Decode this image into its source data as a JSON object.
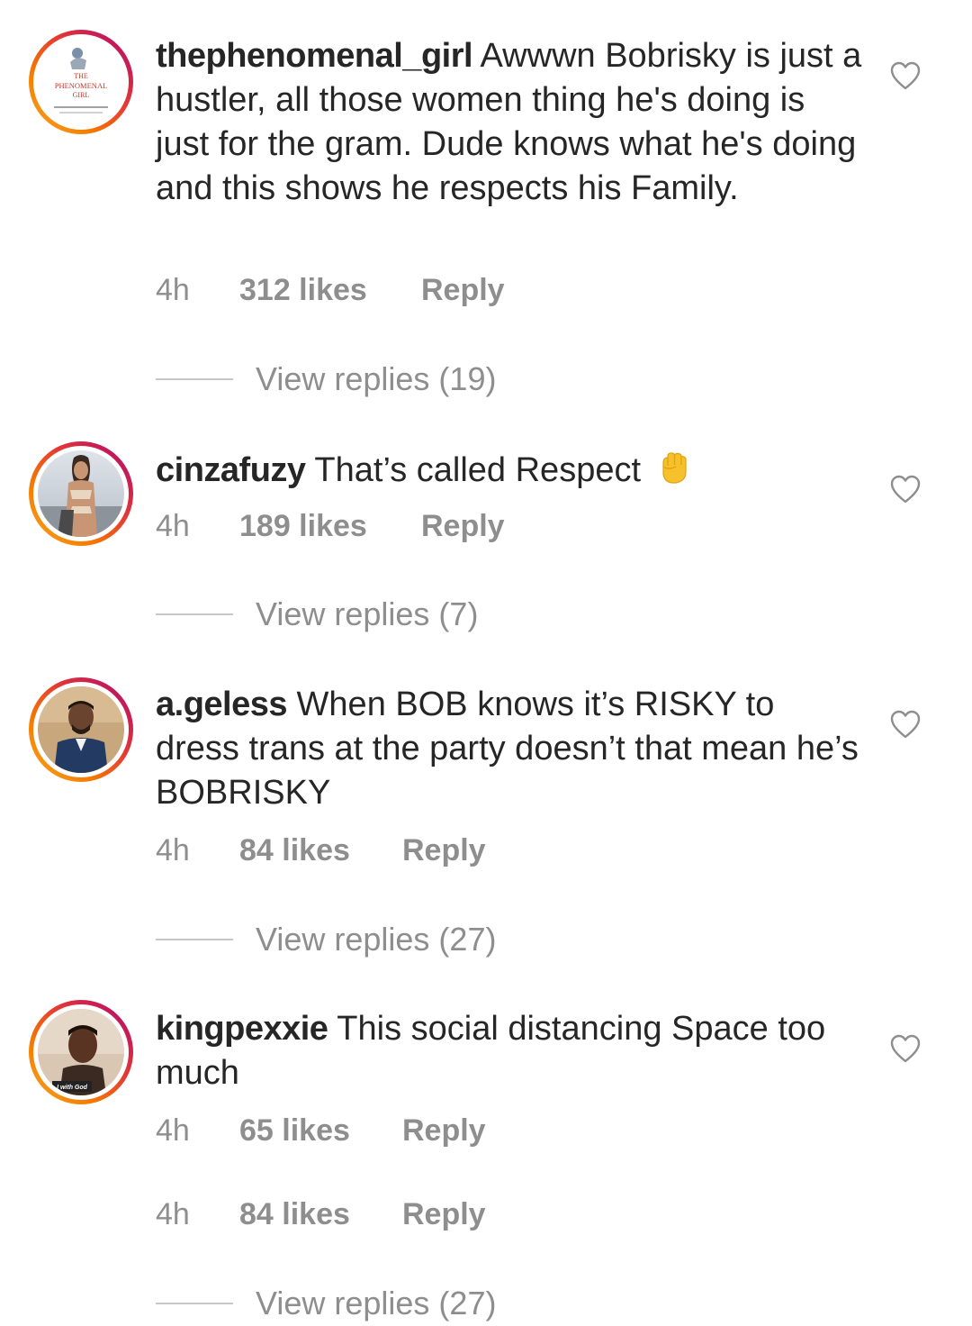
{
  "comments": [
    {
      "username": "thephenomenal_girl",
      "text": " Awwwn Bobrisky is just a hustler, all those women thing he's doing is just for the gram. Dude knows what he's doing and this shows he respects his Family.",
      "avatar_lines": [
        "THE",
        "PHENOMENAL",
        "GIRL"
      ],
      "time": "4h",
      "likes": "312 likes",
      "reply": "Reply",
      "view_replies": "View replies (19)"
    },
    {
      "username": "cinzafuzy",
      "text": " That’s called Respect ",
      "emoji": "✊",
      "time": "4h",
      "likes": "189 likes",
      "reply": "Reply",
      "view_replies": "View replies (7)"
    },
    {
      "username": "a.geless",
      "text": " When BOB knows it’s RISKY to dress trans at the party doesn’t that mean he’s BOBRISKY",
      "time": "4h",
      "likes": "84 likes",
      "reply": "Reply",
      "view_replies": "View replies (27)"
    },
    {
      "username": "kingpexxie",
      "text": " This social distancing Space too much",
      "avatar_caption": "I with God",
      "time": "4h",
      "likes": "65 likes",
      "reply": "Reply",
      "extra_meta": {
        "time": "4h",
        "likes": "84 likes",
        "reply": "Reply"
      },
      "view_replies": "View replies (27)"
    }
  ]
}
